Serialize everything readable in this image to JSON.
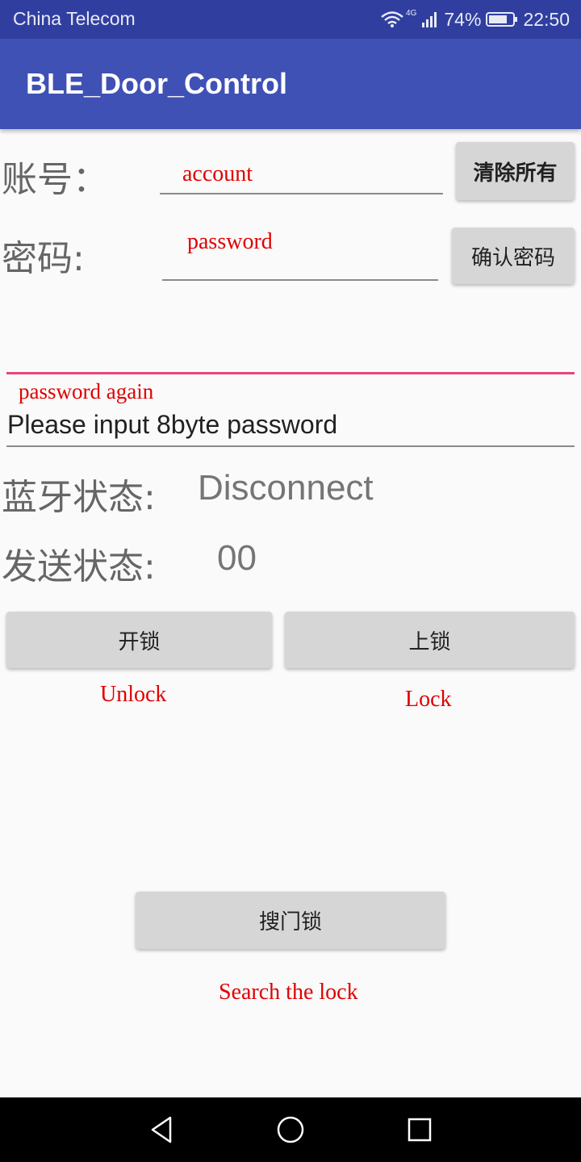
{
  "status_bar": {
    "carrier": "China Telecom",
    "network_type": "4G",
    "battery": "74%",
    "time": "22:50",
    "icons": [
      "wifi-icon",
      "signal-icon",
      "battery-icon"
    ]
  },
  "app_bar": {
    "title": "BLE_Door_Control"
  },
  "account": {
    "label": "账号：",
    "hint": "account",
    "clear_button": "清除所有"
  },
  "password": {
    "label": "密码:",
    "hint": "password",
    "confirm_button": "确认密码"
  },
  "password_again": {
    "hint": "password again",
    "value": "Please input 8byte password"
  },
  "bluetooth_status": {
    "label": "蓝牙状态:",
    "value": "Disconnect"
  },
  "send_status": {
    "label": "发送状态:",
    "value": "00"
  },
  "actions": {
    "unlock_button": "开锁",
    "unlock_hint": "Unlock",
    "lock_button": "上锁",
    "lock_hint": "Lock",
    "search_button": "搜门锁",
    "search_hint": "Search the lock"
  },
  "colors": {
    "primary": "#3f51b5",
    "primary_dark": "#303f9f",
    "accent": "#e6467a",
    "annotation_red": "#e00000",
    "button_gray": "#d6d6d6"
  },
  "nav_bar": {
    "icons": [
      "back-icon",
      "home-icon",
      "recents-icon"
    ]
  }
}
